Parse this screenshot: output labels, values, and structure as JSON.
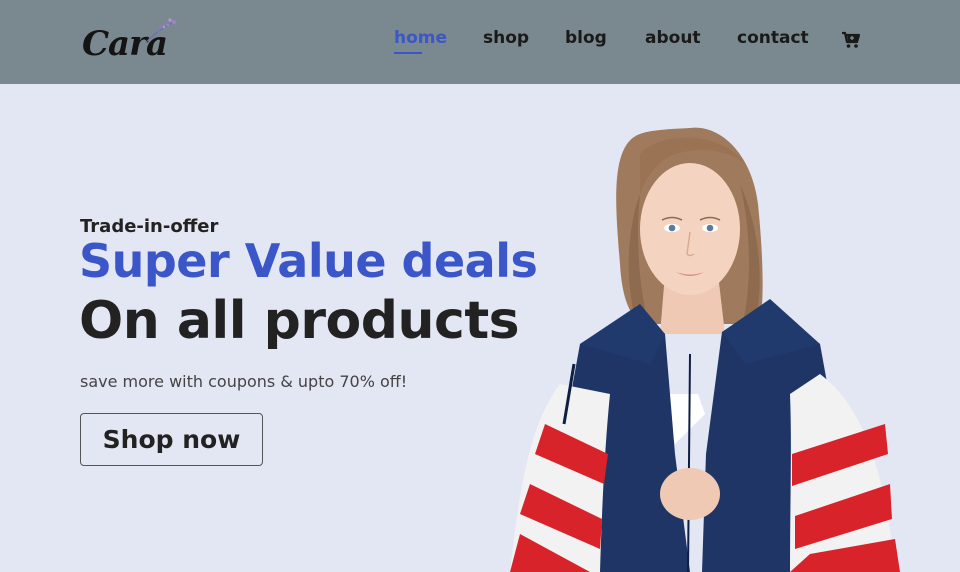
{
  "brand": {
    "logo_text": "Cara"
  },
  "nav": {
    "items": [
      {
        "label": "home",
        "active": true
      },
      {
        "label": "shop",
        "active": false
      },
      {
        "label": "blog",
        "active": false
      },
      {
        "label": "about",
        "active": false
      },
      {
        "label": "contact",
        "active": false
      }
    ],
    "cart_icon": "cart-icon"
  },
  "hero": {
    "eyebrow": "Trade-in-offer",
    "headline_accent": "Super Value deals",
    "headline_main": "On all products",
    "subtext": "save more with coupons & upto 70% off!",
    "cta_label": "Shop now"
  },
  "colors": {
    "header_bg": "#7a8890",
    "page_bg": "#e3e6f3",
    "accent": "#3a56c8",
    "text_dark": "#222222"
  }
}
